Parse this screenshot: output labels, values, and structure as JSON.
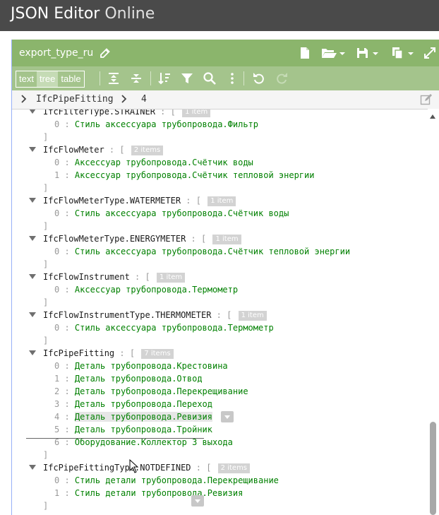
{
  "app": {
    "title_strong": "JSON Editor",
    "title_light": " Online"
  },
  "document": {
    "name": "export_type_ru"
  },
  "toolbar": {
    "modes": [
      "text",
      "tree",
      "table"
    ],
    "active_mode": "tree"
  },
  "navigation": {
    "segments": [
      "IfcPipeFitting",
      "4"
    ]
  },
  "tree": {
    "groups": [
      {
        "key": "IfcFilterType.STRAINER",
        "badge": "1 item",
        "items": [
          {
            "index": "0",
            "value": "Стиль аксессуара трубопровода.Фильтр"
          }
        ]
      },
      {
        "key": "IfcFlowMeter",
        "badge": "2 items",
        "items": [
          {
            "index": "0",
            "value": "Аксессуар трубопровода.Счётчик воды"
          },
          {
            "index": "1",
            "value": "Аксессуар трубопровода.Счётчик тепловой энергии"
          }
        ]
      },
      {
        "key": "IfcFlowMeterType.WATERMETER",
        "badge": "1 item",
        "items": [
          {
            "index": "0",
            "value": "Стиль аксессуара трубопровода.Счётчик воды"
          }
        ]
      },
      {
        "key": "IfcFlowMeterType.ENERGYMETER",
        "badge": "1 item",
        "items": [
          {
            "index": "0",
            "value": "Стиль аксессуара трубопровода.Счётчик тепловой энергии"
          }
        ]
      },
      {
        "key": "IfcFlowInstrument",
        "badge": "1 item",
        "items": [
          {
            "index": "0",
            "value": "Аксессуар трубопровода.Термометр"
          }
        ]
      },
      {
        "key": "IfcFlowInstrumentType.THERMOMETER",
        "badge": "1 item",
        "items": [
          {
            "index": "0",
            "value": "Стиль аксессуара трубопровода.Термометр"
          }
        ]
      },
      {
        "key": "IfcPipeFitting",
        "badge": "7 items",
        "items": [
          {
            "index": "0",
            "value": "Деталь трубопровода.Крестовина"
          },
          {
            "index": "1",
            "value": "Деталь трубопровода.Отвод"
          },
          {
            "index": "2",
            "value": "Деталь трубопровода.Перекрещивание"
          },
          {
            "index": "3",
            "value": "Деталь трубопровода.Переход"
          },
          {
            "index": "4",
            "value": "Деталь трубопровода.Ревизия"
          },
          {
            "index": "5",
            "value": "Деталь трубопровода.Тройник"
          },
          {
            "index": "6",
            "value": "Оборудование.Коллектор 3 выхода"
          }
        ]
      },
      {
        "key": "IfcPipeFittingType.NOTDEFINED",
        "badge": "2 items",
        "items": [
          {
            "index": "0",
            "value": "Стиль детали трубопровода.Перекрещивание"
          },
          {
            "index": "1",
            "value": "Стиль детали трубопровода.Ревизия"
          }
        ]
      }
    ],
    "selected": {
      "group": "IfcPipeFitting",
      "index": "4"
    }
  },
  "colors": {
    "header": "#4a4a4a",
    "doc_bar": "#8bb56c",
    "toolbar": "#a4c48c",
    "value": "#008000"
  }
}
